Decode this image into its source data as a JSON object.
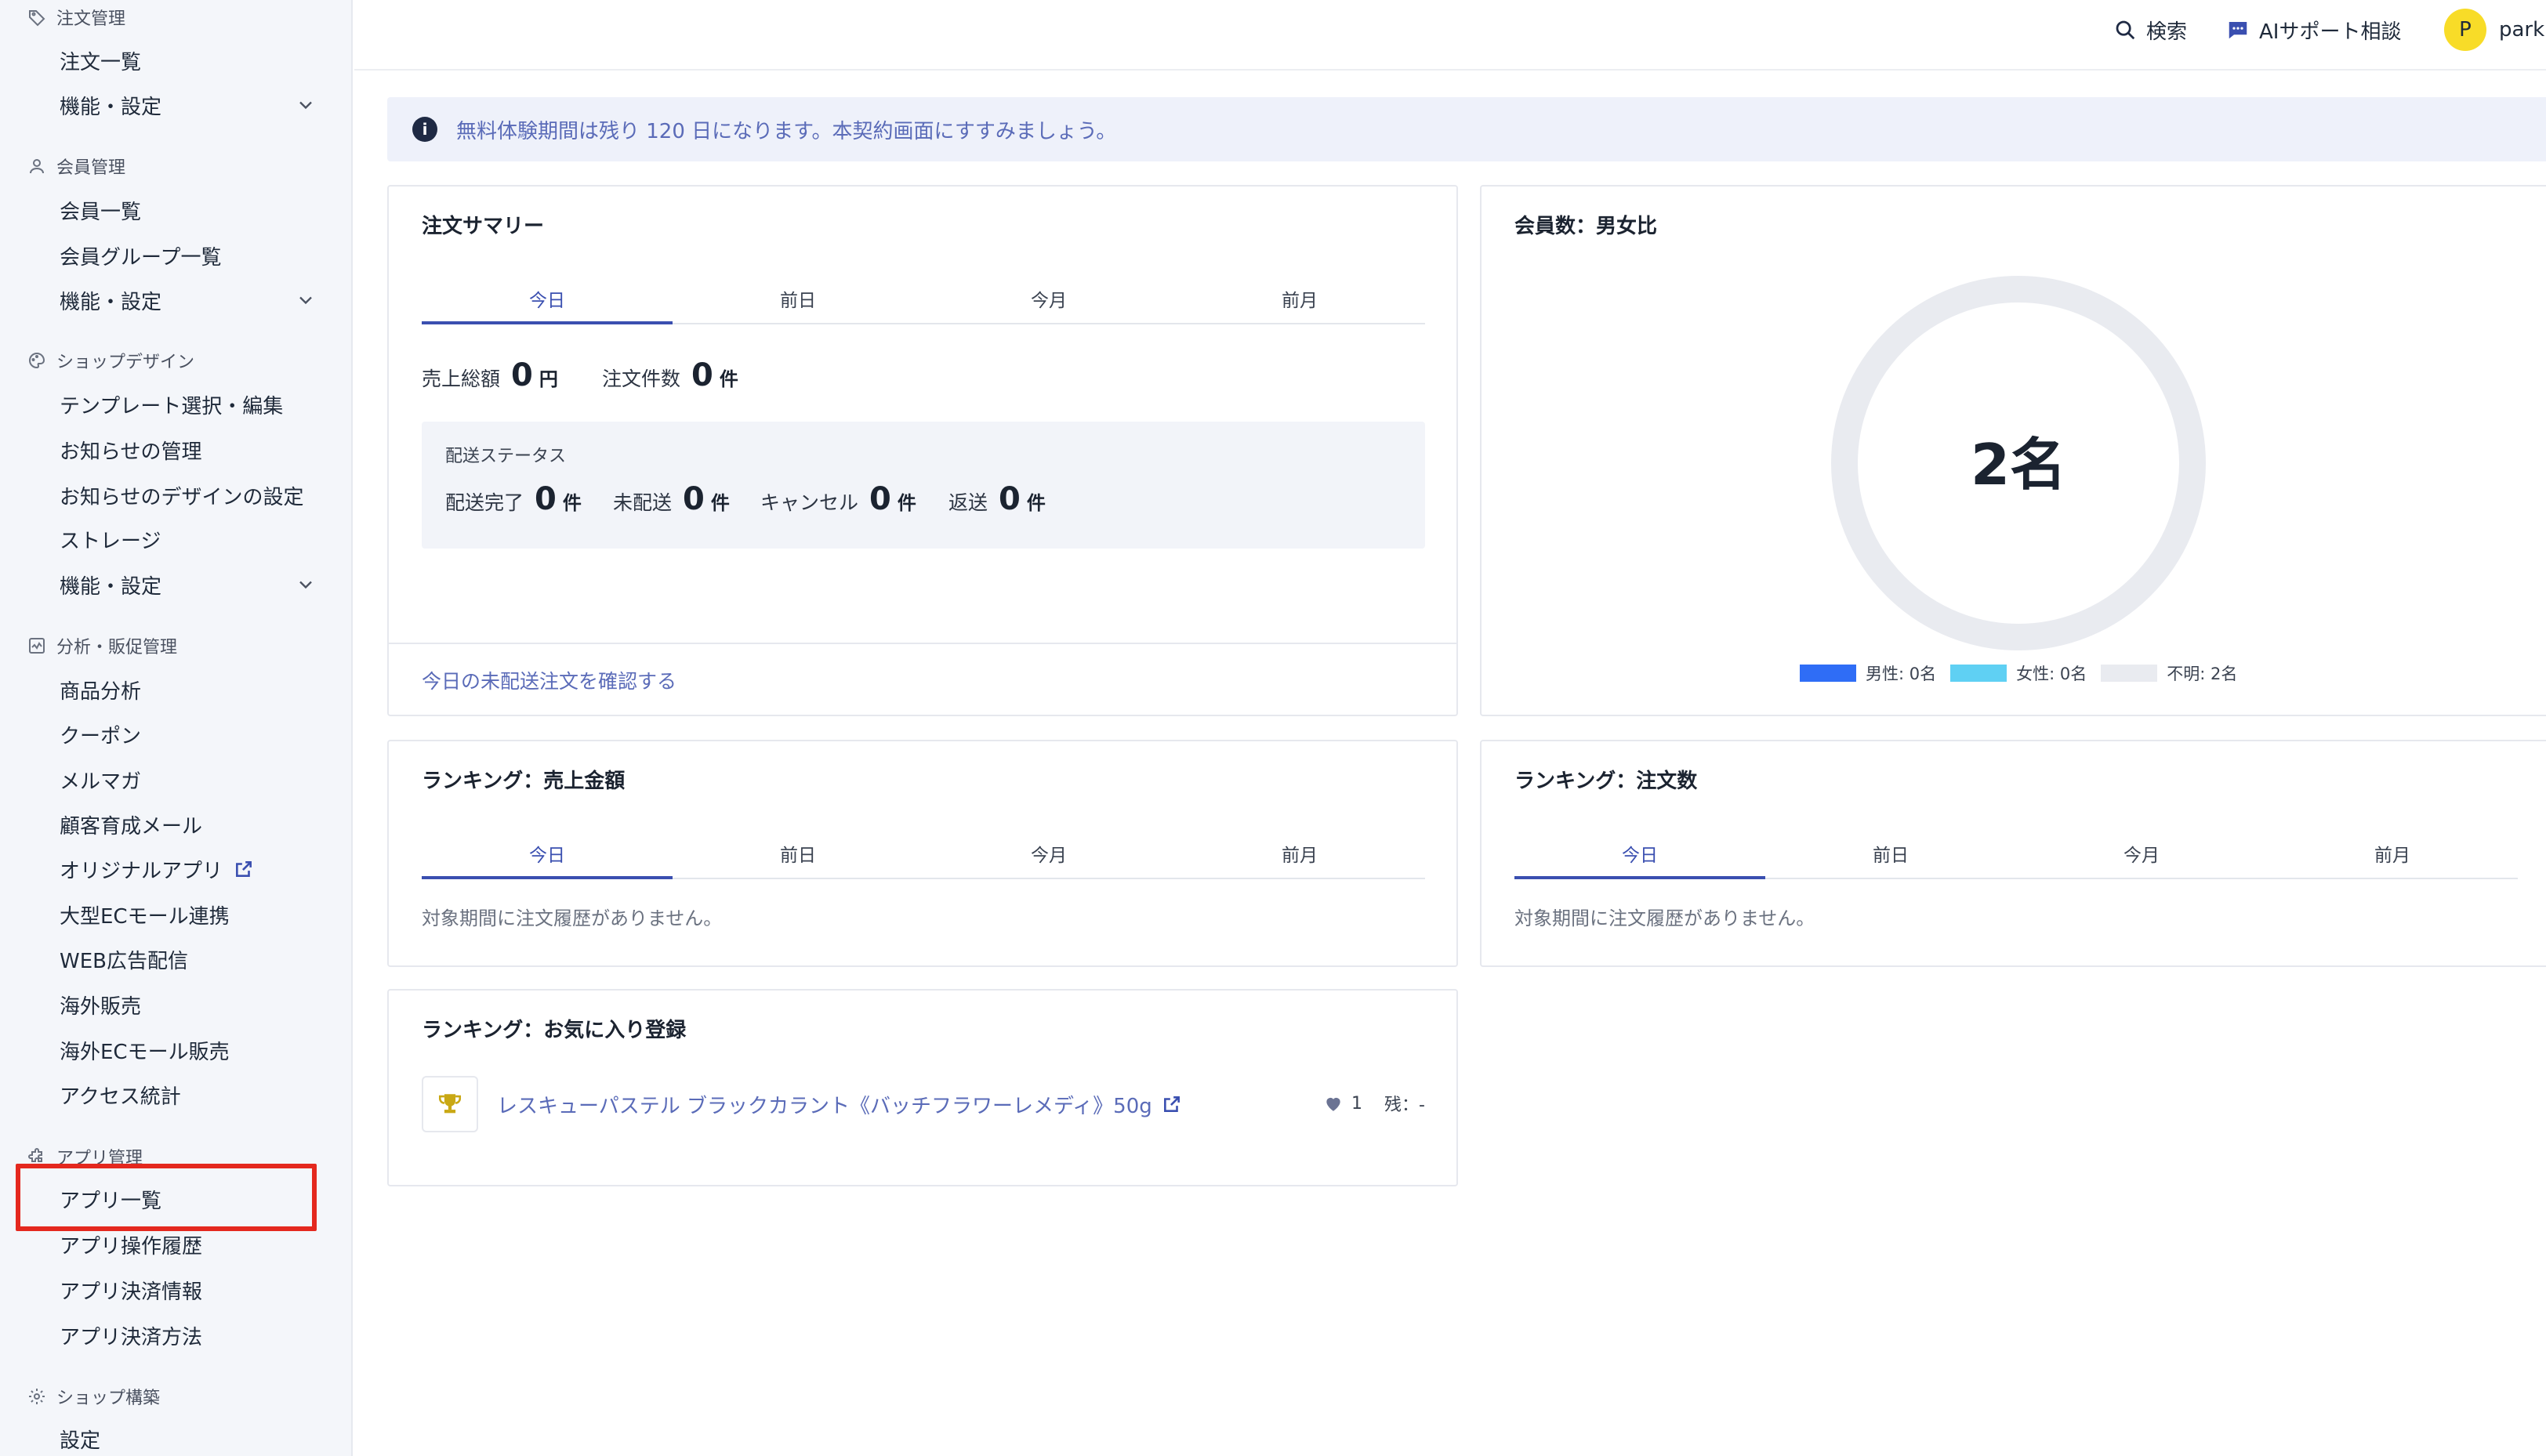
{
  "sidebar": {
    "sections": [
      {
        "label": "注文管理",
        "icon": "tag-icon",
        "items": [
          {
            "label": "注文一覧"
          },
          {
            "label": "機能・設定",
            "expand": true
          }
        ]
      },
      {
        "label": "会員管理",
        "icon": "user-icon",
        "items": [
          {
            "label": "会員一覧"
          },
          {
            "label": "会員グループ一覧"
          },
          {
            "label": "機能・設定",
            "expand": true
          }
        ]
      },
      {
        "label": "ショップデザイン",
        "icon": "palette-icon",
        "items": [
          {
            "label": "テンプレート選択・編集"
          },
          {
            "label": "お知らせの管理"
          },
          {
            "label": "お知らせのデザインの設定"
          },
          {
            "label": "ストレージ"
          },
          {
            "label": "機能・設定",
            "expand": true
          }
        ]
      },
      {
        "label": "分析・販促管理",
        "icon": "chart-icon",
        "items": [
          {
            "label": "商品分析"
          },
          {
            "label": "クーポン"
          },
          {
            "label": "メルマガ"
          },
          {
            "label": "顧客育成メール"
          },
          {
            "label": "オリジナルアプリ",
            "external": true
          },
          {
            "label": "大型ECモール連携"
          },
          {
            "label": "WEB広告配信"
          },
          {
            "label": "海外販売"
          },
          {
            "label": "海外ECモール販売"
          },
          {
            "label": "アクセス統計"
          }
        ]
      },
      {
        "label": "アプリ管理",
        "icon": "puzzle-icon",
        "items": [
          {
            "label": "アプリ一覧"
          },
          {
            "label": "アプリ操作履歴"
          },
          {
            "label": "アプリ決済情報"
          },
          {
            "label": "アプリ決済方法"
          }
        ]
      },
      {
        "label": "ショップ構築",
        "icon": "gear-icon",
        "items": [
          {
            "label": "設定"
          }
        ]
      }
    ]
  },
  "topbar": {
    "search_label": "検索",
    "ai_support_label": "AIサポート相談",
    "avatar_initial": "P",
    "user_name": "park"
  },
  "banner": {
    "text": "無料体験期間は残り 120 日になります。本契約画面にすすみましょう。"
  },
  "period_tabs": [
    "今日",
    "前日",
    "今月",
    "前月"
  ],
  "order_summary": {
    "title": "注文サマリー",
    "sales_total": {
      "label": "売上総額",
      "value": "0",
      "unit": "円"
    },
    "order_count": {
      "label": "注文件数",
      "value": "0",
      "unit": "件"
    },
    "shipping": {
      "title": "配送ステータス",
      "items": [
        {
          "label": "配送完了",
          "value": "0",
          "unit": "件"
        },
        {
          "label": "未配送",
          "value": "0",
          "unit": "件"
        },
        {
          "label": "キャンセル",
          "value": "0",
          "unit": "件"
        },
        {
          "label": "返送",
          "value": "0",
          "unit": "件"
        }
      ]
    },
    "footer_link": "今日の未配送注文を確認する"
  },
  "member_gender": {
    "title": "会員数：男女比",
    "total": "2名",
    "legend": [
      {
        "label": "男性: 0名",
        "color": "#2f6df6"
      },
      {
        "label": "女性: 0名",
        "color": "#5fd0f3"
      },
      {
        "label": "不明: 2名",
        "color": "#e9ebf0"
      }
    ]
  },
  "ranking_sales": {
    "title": "ランキング：売上金額",
    "empty": "対象期間に注文履歴がありません。"
  },
  "ranking_orders": {
    "title": "ランキング：注文数",
    "empty": "対象期間に注文履歴がありません。"
  },
  "ranking_favorites": {
    "title": "ランキング：お気に入り登録",
    "item": {
      "name": "レスキューパステル ブラックカラント《バッチフラワーレメディ》50g",
      "likes": "1",
      "stock": "残：-"
    }
  },
  "colors": {
    "accent": "#3a4fb0",
    "highlight": "#e4281e",
    "sidebar_bg": "#f4f6fa"
  }
}
